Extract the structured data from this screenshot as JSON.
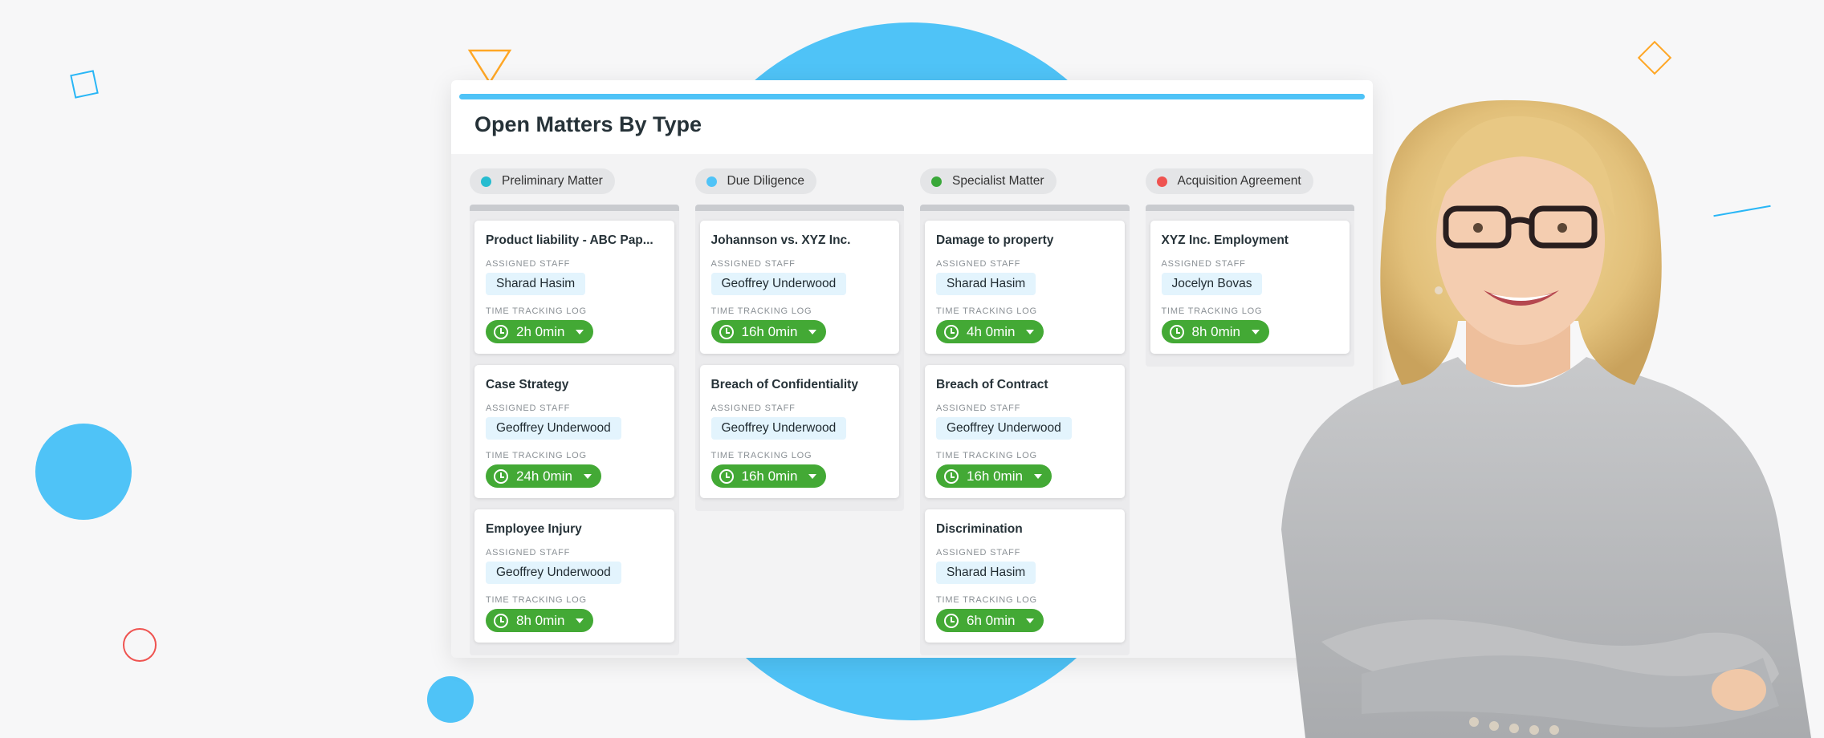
{
  "board": {
    "title": "Open Matters By Type",
    "accent_color": "#4fc3f7",
    "columns": [
      {
        "name": "Preliminary Matter",
        "dot_color": "#26bcd0",
        "cards": [
          {
            "title": "Product liability - ABC Pap...",
            "staff_label": "ASSIGNED STAFF",
            "staff": "Sharad Hasim",
            "time_label": "TIME TRACKING LOG",
            "time": "2h 0min"
          },
          {
            "title": "Case Strategy",
            "staff_label": "ASSIGNED STAFF",
            "staff": "Geoffrey Underwood",
            "time_label": "TIME TRACKING LOG",
            "time": "24h 0min"
          },
          {
            "title": "Employee Injury",
            "staff_label": "ASSIGNED STAFF",
            "staff": "Geoffrey Underwood",
            "time_label": "TIME TRACKING LOG",
            "time": "8h 0min"
          }
        ]
      },
      {
        "name": "Due Diligence",
        "dot_color": "#4fc3f7",
        "cards": [
          {
            "title": "Johannson vs. XYZ Inc.",
            "staff_label": "ASSIGNED STAFF",
            "staff": "Geoffrey Underwood",
            "time_label": "TIME TRACKING LOG",
            "time": "16h 0min"
          },
          {
            "title": "Breach of Confidentiality",
            "staff_label": "ASSIGNED STAFF",
            "staff": "Geoffrey Underwood",
            "time_label": "TIME TRACKING LOG",
            "time": "16h 0min"
          }
        ]
      },
      {
        "name": "Specialist Matter",
        "dot_color": "#3aa83a",
        "cards": [
          {
            "title": "Damage to property",
            "staff_label": "ASSIGNED STAFF",
            "staff": "Sharad Hasim",
            "time_label": "TIME TRACKING LOG",
            "time": "4h 0min"
          },
          {
            "title": "Breach of Contract",
            "staff_label": "ASSIGNED STAFF",
            "staff": "Geoffrey Underwood",
            "time_label": "TIME TRACKING LOG",
            "time": "16h 0min"
          },
          {
            "title": "Discrimination",
            "staff_label": "ASSIGNED STAFF",
            "staff": "Sharad Hasim",
            "time_label": "TIME TRACKING LOG",
            "time": "6h 0min"
          }
        ]
      },
      {
        "name": "Acquisition Agreement",
        "dot_color": "#ef5350",
        "cards": [
          {
            "title": "XYZ Inc. Employment",
            "staff_label": "ASSIGNED STAFF",
            "staff": "Jocelyn Bovas",
            "time_label": "TIME TRACKING LOG",
            "time": "8h 0min"
          }
        ]
      }
    ]
  },
  "colors": {
    "time_badge": "#43a935",
    "staff_chip": "#e3f4fd",
    "background": "#f7f7f8"
  },
  "icons": [
    "clock-icon",
    "caret-down-icon"
  ]
}
